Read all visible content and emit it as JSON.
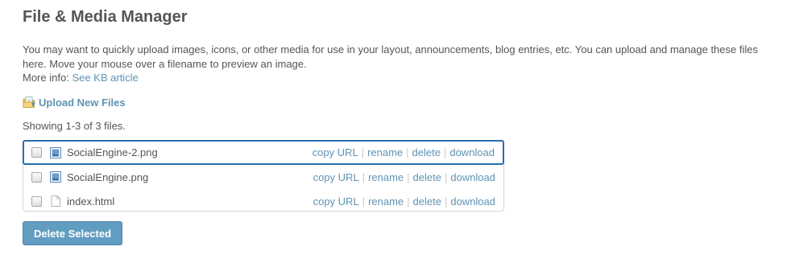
{
  "page": {
    "title": "File & Media Manager",
    "description_line1": "You may want to quickly upload images, icons, or other media for use in your layout, announcements, blog entries, etc. You can upload and manage these files",
    "description_line2": "here. Move your mouse over a filename to preview an image.",
    "more_info_label": "More info:",
    "kb_link": "See KB article"
  },
  "upload": {
    "label": "Upload New Files",
    "icon": "upload-folder-icon"
  },
  "listing": {
    "showing_text": "Showing 1-3 of 3 files."
  },
  "files": [
    {
      "name": "SocialEngine-2.png",
      "type": "image",
      "icon": "image-file-icon",
      "selected": true
    },
    {
      "name": "SocialEngine.png",
      "type": "image",
      "icon": "image-file-icon",
      "selected": false
    },
    {
      "name": "index.html",
      "type": "document",
      "icon": "document-file-icon",
      "selected": false
    }
  ],
  "actions": {
    "copy_url": "copy URL",
    "rename": "rename",
    "delete": "delete",
    "download": "download",
    "separator": "|"
  },
  "buttons": {
    "delete_selected": "Delete Selected"
  },
  "colors": {
    "link": "#5f93b4",
    "accent_button": "#619dc0",
    "selected_border": "#2a6eb0",
    "text": "#555555"
  }
}
